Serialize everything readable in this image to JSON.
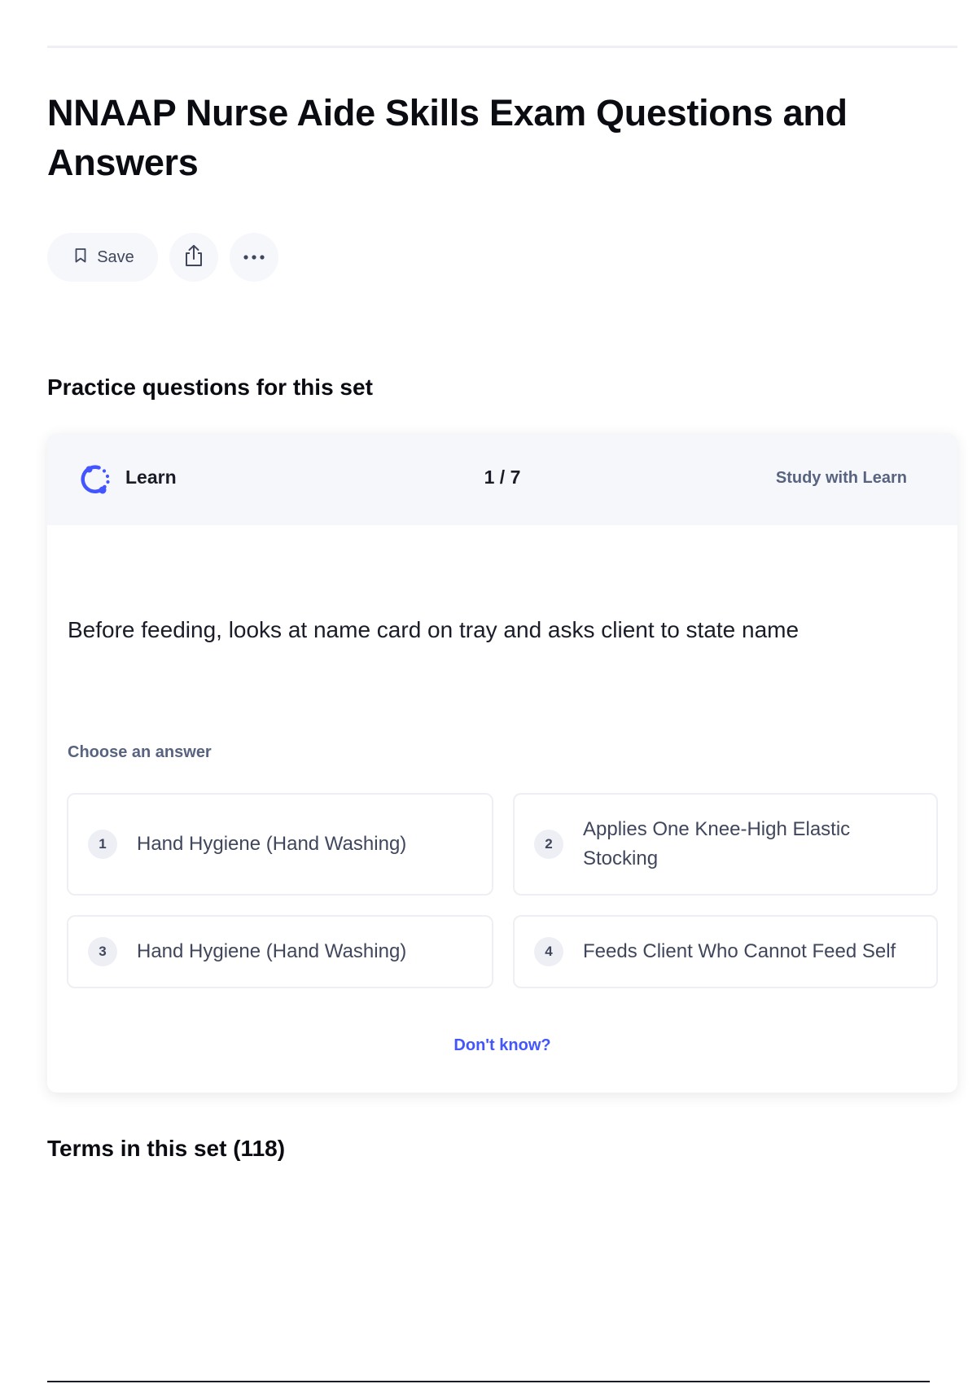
{
  "page": {
    "title": "NNAAP Nurse Aide Skills Exam Questions and Answers"
  },
  "actions": {
    "save_label": "Save",
    "share_icon": "share-icon",
    "more_icon": "more-icon"
  },
  "practice": {
    "heading": "Practice questions for this set",
    "learn_label": "Learn",
    "counter": "1 / 7",
    "study_link": "Study with Learn",
    "question": "Before feeding, looks at name card on tray and asks client to state name",
    "choose_label": "Choose an answer",
    "answers": [
      {
        "number": "1",
        "text": "Hand Hygiene (Hand Washing)"
      },
      {
        "number": "2",
        "text": "Applies One Knee-High Elastic Stocking"
      },
      {
        "number": "3",
        "text": "Hand Hygiene (Hand Washing)"
      },
      {
        "number": "4",
        "text": "Feeds Client Who Cannot Feed Self"
      }
    ],
    "dont_know": "Don't know?"
  },
  "terms": {
    "heading": "Terms in this set (118)"
  },
  "colors": {
    "accent": "#4255ff",
    "muted_text": "#586380",
    "header_bg": "#f6f7fb"
  }
}
